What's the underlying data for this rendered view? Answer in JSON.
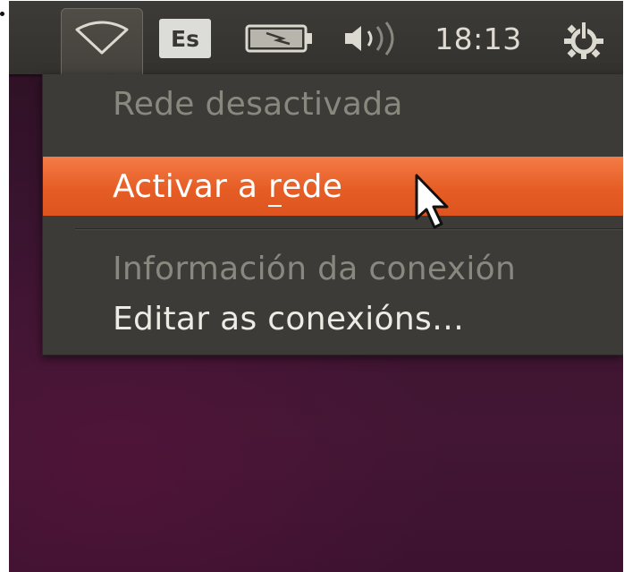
{
  "panel": {
    "indicators": {
      "network_icon": "wifi-icon",
      "keyboard_layout": "Es",
      "battery_icon": "battery-charging-icon",
      "volume_icon": "volume-icon",
      "clock": "18:13",
      "session_icon": "power-gear-icon"
    }
  },
  "network_menu": {
    "items": [
      {
        "label": "Rede desactivada",
        "enabled": false
      },
      {
        "label_before": "Activar a ",
        "label_mnemonic": "r",
        "label_after": "ede",
        "highlighted": true
      },
      {
        "label": "Información da conexión",
        "enabled": false
      },
      {
        "label": "Editar as conexións…",
        "enabled": true
      }
    ]
  },
  "colors": {
    "panel_bg": "#3c3b37",
    "menu_bg": "#3c3b37",
    "highlight": "#e95420",
    "disabled_text": "#8a877f",
    "desktop": "#3a1430"
  }
}
